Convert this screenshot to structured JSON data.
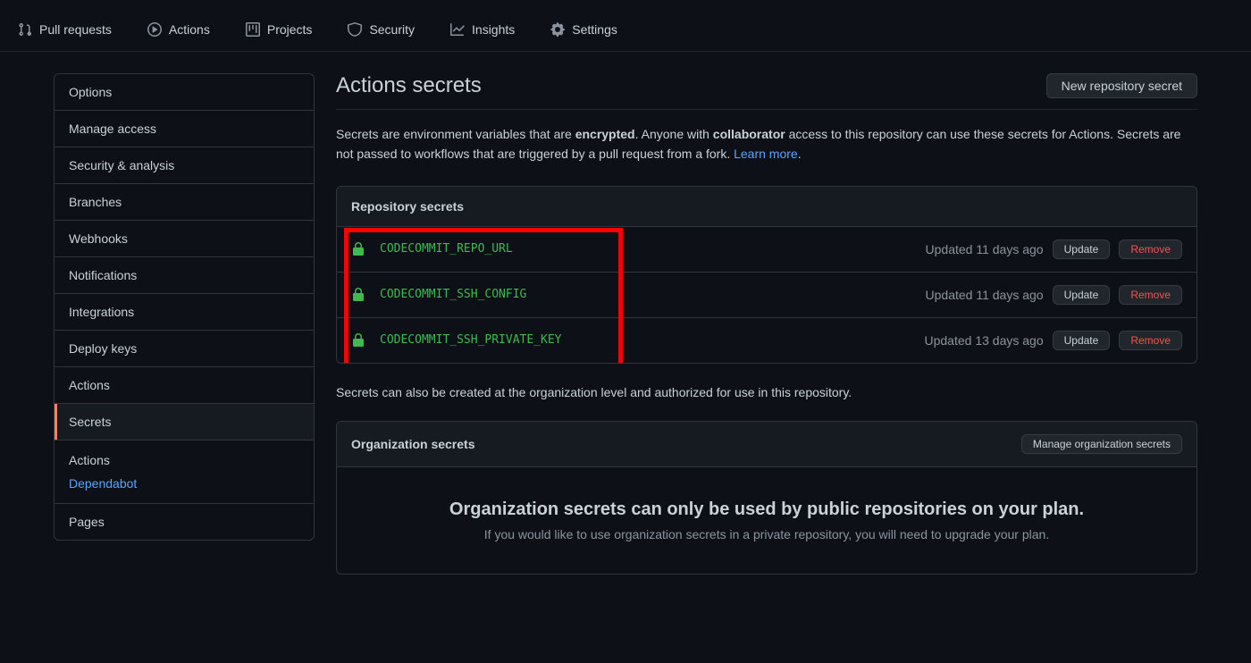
{
  "topnav": [
    {
      "icon": "git-pull",
      "label": "Pull requests"
    },
    {
      "icon": "play",
      "label": "Actions"
    },
    {
      "icon": "project",
      "label": "Projects"
    },
    {
      "icon": "shield",
      "label": "Security"
    },
    {
      "icon": "graph",
      "label": "Insights"
    },
    {
      "icon": "gear",
      "label": "Settings"
    }
  ],
  "sidebar": {
    "items": [
      "Options",
      "Manage access",
      "Security & analysis",
      "Branches",
      "Webhooks",
      "Notifications",
      "Integrations",
      "Deploy keys",
      "Actions",
      "Secrets"
    ],
    "active": "Secrets",
    "sub_head": "Actions",
    "sub_link": "Dependabot",
    "last": "Pages"
  },
  "page": {
    "title": "Actions secrets",
    "new_button": "New repository secret",
    "intro_pre": "Secrets are environment variables that are ",
    "intro_b1": "encrypted",
    "intro_mid": ". Anyone with ",
    "intro_b2": "collaborator",
    "intro_post": " access to this repository can use these secrets for Actions. Secrets are not passed to workflows that are triggered by a pull request from a fork. ",
    "learn_more": "Learn more",
    "intro_dot": "."
  },
  "repo_secrets": {
    "title": "Repository secrets",
    "items": [
      {
        "name": "CODECOMMIT_REPO_URL",
        "updated": "Updated 11 days ago"
      },
      {
        "name": "CODECOMMIT_SSH_CONFIG",
        "updated": "Updated 11 days ago"
      },
      {
        "name": "CODECOMMIT_SSH_PRIVATE_KEY",
        "updated": "Updated 13 days ago"
      }
    ],
    "update": "Update",
    "remove": "Remove"
  },
  "between": "Secrets can also be created at the organization level and authorized for use in this repository.",
  "org_secrets": {
    "title": "Organization secrets",
    "manage": "Manage organization secrets",
    "body_title": "Organization secrets can only be used by public repositories on your plan.",
    "body_sub": "If you would like to use organization secrets in a private repository, you will need to upgrade your plan."
  }
}
